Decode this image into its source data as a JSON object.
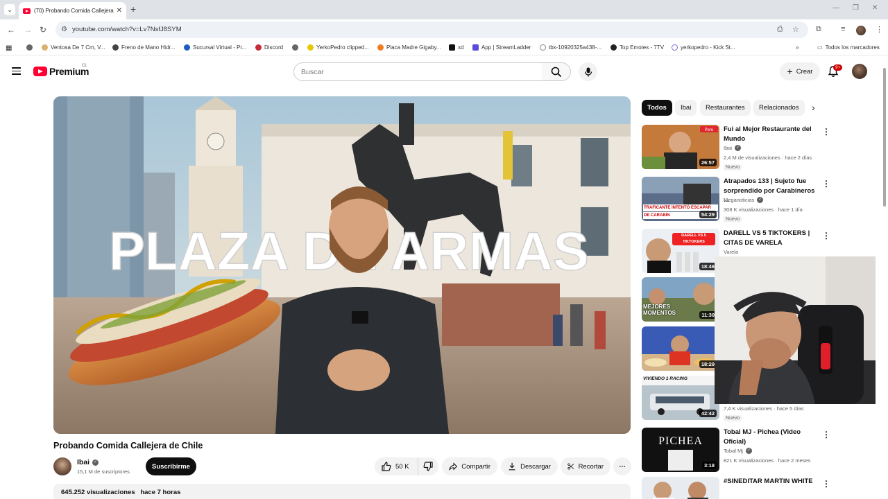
{
  "browser": {
    "tab_title": "(70) Probando Comida Callejera",
    "url": "youtube.com/watch?v=Lv7NsfJ8SYM",
    "bookmarks": [
      "Ventosa De 7 Cm, V...",
      "Freno de Mano Hidr...",
      "Sucursal Virtual - Pr...",
      "Discord",
      "YerkoPedro clipped...",
      "Placa Madre Gigaby...",
      "xd",
      "App | StreamLadder",
      "tbx-10920325a438-...",
      "Top Emotes - 7TV",
      "yerkopedro - Kick St..."
    ],
    "all_bookmarks": "Todos los marcadores"
  },
  "masthead": {
    "logo_text": "Premium",
    "country": "CL",
    "search_placeholder": "Buscar",
    "create_label": "Crear",
    "notif_count": "9+"
  },
  "video": {
    "overlay_text": "PLAZA DE ARMAS",
    "title": "Probando Comida Callejera de Chile",
    "channel": "Ibai",
    "subscribers": "15,1 M de suscriptores",
    "subscribe_label": "Suscribirme",
    "likes": "50 K",
    "share_label": "Compartir",
    "download_label": "Descargar",
    "clip_label": "Recortar",
    "views": "645.252 visualizaciones",
    "age": "hace 7 horas"
  },
  "chips": [
    "Todos",
    "Ibai",
    "Restaurantes",
    "Relacionados"
  ],
  "recommendations": [
    {
      "title": "Fui al Mejor Restaurante del Mundo",
      "channel": "Ibai",
      "verified": true,
      "meta": "2,4 M de visualizaciones · hace 2 días",
      "badge": "Nuevo",
      "duration": "26:57",
      "thumb_label": "Perú"
    },
    {
      "title": "Atrapados 133 | Sujeto fue sorprendido por Carabineros ...",
      "channel": "Meganoticias",
      "verified": true,
      "meta": "308 K visualizaciones · hace 1 día",
      "badge": "Nuevo",
      "duration": "54:29",
      "thumb_label": "TRAFICANTE INTENTÓ ESCAPAR DE CARABIN"
    },
    {
      "title": "DARELL VS 5 TIKTOKERS | CITAS DE VARELA",
      "channel": "Varela",
      "verified": false,
      "meta": "",
      "badge": "",
      "duration": "18:46",
      "thumb_label": "DARELL VS 5 TIKTOKERS"
    },
    {
      "title": "",
      "channel": "",
      "verified": false,
      "meta": "",
      "badge": "",
      "duration": "11:30",
      "thumb_label": "MEJORES MOMENTOS"
    },
    {
      "title": "",
      "channel": "",
      "verified": false,
      "meta": "",
      "badge": "",
      "duration": "18:29",
      "thumb_label": ""
    },
    {
      "title": "",
      "channel": "",
      "verified": false,
      "meta": "7,4 K visualizaciones · hace 5 días",
      "badge": "Nuevo",
      "duration": "42:42",
      "thumb_label": "VIVIENDO 1 RACING"
    },
    {
      "title": "Tobal MJ - Pichea (Video Oficial)",
      "channel": "Tobal Mj",
      "verified": true,
      "meta": "821 K visualizaciones · hace 2 meses",
      "badge": "",
      "duration": "3:18",
      "thumb_label": "PICHEA"
    },
    {
      "title": "#SINEDITAR MARTIN WHITE",
      "channel": "",
      "verified": false,
      "meta": "",
      "badge": "",
      "duration": "",
      "thumb_label": ""
    }
  ],
  "colors": {
    "brand": "#ff0033",
    "text": "#0f0f0f",
    "secondary": "#606060",
    "chip_bg": "#f2f2f2"
  }
}
